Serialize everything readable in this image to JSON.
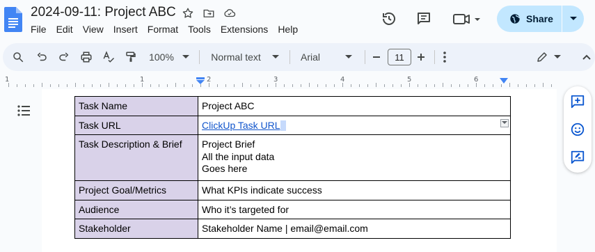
{
  "header": {
    "title": "2024-09-11: Project ABC",
    "menus": [
      "File",
      "Edit",
      "View",
      "Insert",
      "Format",
      "Tools",
      "Extensions",
      "Help"
    ],
    "share_label": "Share"
  },
  "toolbar": {
    "zoom": "100%",
    "style": "Normal text",
    "font": "Arial",
    "font_size": "11"
  },
  "ruler": {
    "labels": [
      "1",
      "1",
      "2",
      "3",
      "4",
      "5",
      "6"
    ]
  },
  "table": {
    "rows": [
      {
        "key": "Task Name",
        "value": [
          "Project ABC"
        ]
      },
      {
        "key": "Task URL",
        "value": [
          "ClickUp Task URL"
        ]
      },
      {
        "key": "Task Description & Brief",
        "value": [
          "Project Brief",
          "All the input data",
          "Goes here"
        ]
      },
      {
        "key": "Project Goal/Metrics",
        "value": [
          "What KPIs indicate success"
        ]
      },
      {
        "key": "Audience",
        "value": [
          "Who it’s targeted for"
        ]
      },
      {
        "key": "Stakeholder",
        "value": [
          "Stakeholder Name | email@email.com"
        ]
      }
    ]
  },
  "colors": {
    "key_cell_bg": "#d9d2e9",
    "share_bg": "#c2e7ff",
    "link": "#1155cc",
    "doc_icon": "#4285f4"
  }
}
